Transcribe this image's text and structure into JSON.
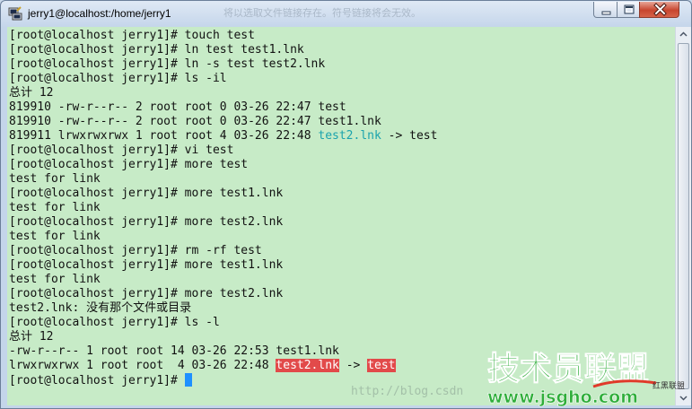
{
  "window": {
    "title": "jerry1@localhost:/home/jerry1",
    "faded_title_text": "将以选取文件链接存在。符号链接将会无效。"
  },
  "terminal": {
    "lines": [
      {
        "segments": [
          {
            "text": "[root@localhost jerry1]# touch test"
          }
        ]
      },
      {
        "segments": [
          {
            "text": "[root@localhost jerry1]# ln test test1.lnk"
          }
        ]
      },
      {
        "segments": [
          {
            "text": "[root@localhost jerry1]# ln -s test test2.lnk"
          }
        ]
      },
      {
        "segments": [
          {
            "text": "[root@localhost jerry1]# ls -il"
          }
        ]
      },
      {
        "segments": [
          {
            "text": "总计 12"
          }
        ]
      },
      {
        "segments": [
          {
            "text": "819910 -rw-r--r-- 2 root root 0 03-26 22:47 test"
          }
        ]
      },
      {
        "segments": [
          {
            "text": "819910 -rw-r--r-- 2 root root 0 03-26 22:47 test1.lnk"
          }
        ]
      },
      {
        "segments": [
          {
            "text": "819911 lrwxrwxrwx 1 root root 4 03-26 22:48 "
          },
          {
            "text": "test2.lnk",
            "style": "cyan"
          },
          {
            "text": " -> test"
          }
        ]
      },
      {
        "segments": [
          {
            "text": "[root@localhost jerry1]# vi test"
          }
        ]
      },
      {
        "segments": [
          {
            "text": "[root@localhost jerry1]# more test"
          }
        ]
      },
      {
        "segments": [
          {
            "text": "test for link"
          }
        ]
      },
      {
        "segments": [
          {
            "text": "[root@localhost jerry1]# more test1.lnk"
          }
        ]
      },
      {
        "segments": [
          {
            "text": "test for link"
          }
        ]
      },
      {
        "segments": [
          {
            "text": "[root@localhost jerry1]# more test2.lnk"
          }
        ]
      },
      {
        "segments": [
          {
            "text": "test for link"
          }
        ]
      },
      {
        "segments": [
          {
            "text": "[root@localhost jerry1]# rm -rf test"
          }
        ]
      },
      {
        "segments": [
          {
            "text": "[root@localhost jerry1]# more test1.lnk"
          }
        ]
      },
      {
        "segments": [
          {
            "text": "test for link"
          }
        ]
      },
      {
        "segments": [
          {
            "text": "[root@localhost jerry1]# more test2.lnk"
          }
        ]
      },
      {
        "segments": [
          {
            "text": "test2.lnk: 没有那个文件或目录"
          }
        ]
      },
      {
        "segments": [
          {
            "text": "[root@localhost jerry1]# ls -l"
          }
        ]
      },
      {
        "segments": [
          {
            "text": "总计 12"
          }
        ]
      },
      {
        "segments": [
          {
            "text": "-rw-r--r-- 1 root root 14 03-26 22:53 test1.lnk"
          }
        ]
      },
      {
        "segments": [
          {
            "text": "lrwxrwxrwx 1 root root  4 03-26 22:48 "
          },
          {
            "text": "test2.lnk",
            "style": "hl-red"
          },
          {
            "text": " -> "
          },
          {
            "text": "test",
            "style": "hl-red"
          }
        ]
      },
      {
        "segments": [
          {
            "text": "[root@localhost jerry1]# "
          }
        ],
        "cursor": true
      }
    ]
  },
  "watermark": {
    "url": "http://blog.csdn",
    "logo_main": "技术员联盟",
    "logo_url": "www.jsgho.com",
    "logo_side": "红黑联盟"
  },
  "colors": {
    "terminal_bg": "#c7ebc7",
    "symlink_cyan": "#1aa3ad",
    "broken_link_red": "#e24a4a",
    "cursor_blue": "#1e90ff"
  },
  "icons": {
    "app": "putty-icon",
    "minimize": "minimize-icon",
    "maximize": "maximize-icon",
    "close": "close-icon",
    "scroll_up": "chevron-up-icon",
    "scroll_down": "chevron-down-icon"
  }
}
